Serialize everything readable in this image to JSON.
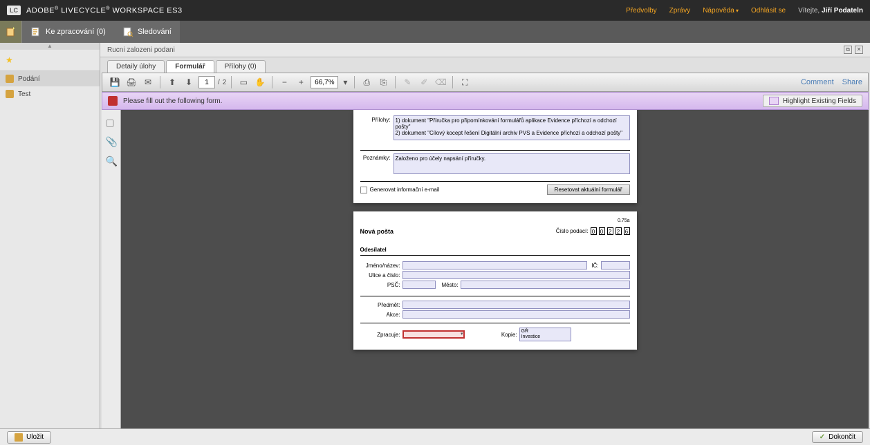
{
  "header": {
    "lc_badge": "LC",
    "app_title_1": "ADOBE",
    "app_title_2": "LIVECYCLE",
    "app_title_3": "WORKSPACE ES3",
    "links": {
      "predvolby": "Předvolby",
      "zpravy": "Zprávy",
      "napoveda": "Nápověda",
      "odhlasit": "Odhlásit se"
    },
    "welcome_prefix": "Vítejte,",
    "welcome_user": "Jiří Podateln"
  },
  "nav": {
    "ke_zprac": "Ke zpracování (0)",
    "sledovani": "Sledování"
  },
  "sidebar": {
    "podani": "Podání",
    "test": "Test"
  },
  "breadcrumb": "Rucni zalozeni podani",
  "tabs": {
    "detaily": "Detaily úlohy",
    "formular": "Formulář",
    "prilohy": "Přílohy (0)"
  },
  "toolbar": {
    "page_current": "1",
    "page_sep": "/",
    "page_total": "2",
    "zoom": "66,7%",
    "comment": "Comment",
    "share": "Share"
  },
  "infobar": {
    "msg": "Please fill out the following form.",
    "highlight": "Highlight Existing Fields"
  },
  "form": {
    "prilohy_label": "Přílohy:",
    "prilohy_value": "1) dokument \"Příručka pro připomínkování formulářů aplikace Evidence příchozí a odchozí pošty\"\n2) dokument \"Cílový kocept řešení Digitální archiv PVS a Evidence příchozí a odchozí pošty\"",
    "poznamky_label": "Poznámky:",
    "poznamky_value": "Založeno pro účely napsání příručky.",
    "gen_email": "Generovat informační e-mail",
    "reset": "Resetovat aktuální formulář"
  },
  "page2": {
    "version": "0.75a",
    "title": "Nová pošta",
    "cislo_label": "Číslo podací:",
    "cislo_digits": [
      "0",
      "0",
      "2",
      "2",
      "6"
    ],
    "odesilatel": "Odesílatel",
    "jmeno": "Jméno/název:",
    "ic": "IČ:",
    "ulice": "Ulice a číslo:",
    "psc": "PSČ:",
    "mesto": "Město:",
    "predmet": "Předmět:",
    "akce": "Akce:",
    "zpracuje": "Zpracuje:",
    "kopie": "Kopie:",
    "kopie_val1": "GŘ",
    "kopie_val2": "Investice"
  },
  "actions": {
    "ulozit": "Uložit",
    "dokoncit": "Dokončit"
  }
}
